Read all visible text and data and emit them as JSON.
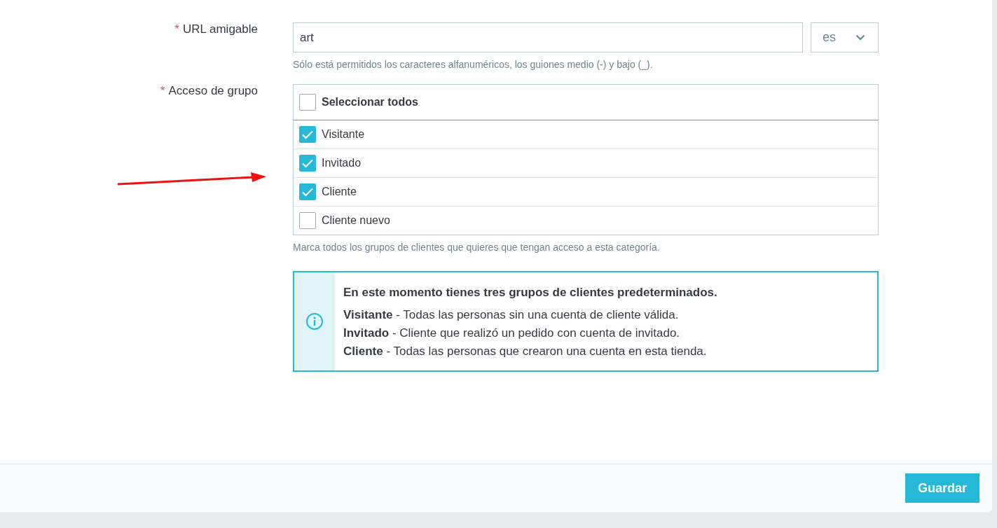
{
  "fields": [
    {
      "kind": "text",
      "mark": "*",
      "label": "URL amigable",
      "value": "art",
      "language": "es",
      "help": "Sólo está permitidos los caracteres alfanuméricos, los guiones medio (-) y bajo (_)."
    },
    {
      "kind": "checklist",
      "mark": "*",
      "label": "Acceso de grupo",
      "select_all": {
        "label": "Seleccionar todos",
        "checked": false
      },
      "options": [
        {
          "label": "Visitante",
          "checked": true
        },
        {
          "label": "Invitado",
          "checked": true
        },
        {
          "label": "Cliente",
          "checked": true
        },
        {
          "label": "Cliente nuevo",
          "checked": false
        }
      ],
      "help": "Marca todos los grupos de clientes que quieres que tengan acceso a esta categoría."
    }
  ],
  "info": {
    "title": "En este momento tienes tres grupos de clientes predeterminados.",
    "lines": [
      "**Visitante** - Todas las personas sin una cuenta de cliente válida.",
      "**Invitado** - Cliente que realizó un pedido con cuenta de invitado.",
      "**Cliente** - Todas las personas que crearon una cuenta en esta tienda."
    ]
  },
  "buttons": [
    {
      "label": "Guardar"
    }
  ]
}
